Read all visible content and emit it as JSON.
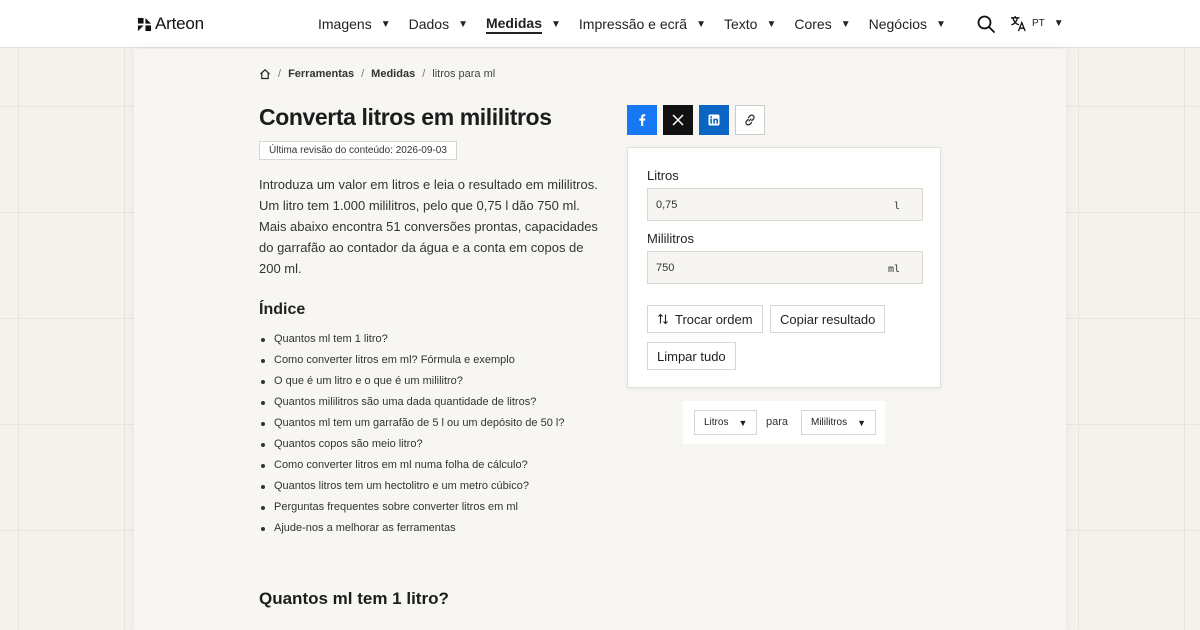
{
  "header": {
    "brand": "Arteon",
    "nav": [
      {
        "label": "Imagens",
        "active": false
      },
      {
        "label": "Dados",
        "active": false
      },
      {
        "label": "Medidas",
        "active": true
      },
      {
        "label": "Impressão e ecrã",
        "active": false
      },
      {
        "label": "Texto",
        "active": false
      },
      {
        "label": "Cores",
        "active": false
      },
      {
        "label": "Negócios",
        "active": false
      }
    ],
    "lang_code": "PT"
  },
  "breadcrumb": {
    "items": [
      "Ferramentas",
      "Medidas"
    ],
    "current": "litros para ml"
  },
  "page": {
    "title": "Converta litros em mililitros",
    "revision": "Última revisão do conteúdo: 2026-09-03",
    "intro": "Introduza um valor em litros e leia o resultado em mililitros. Um litro tem 1.000 mililitros, pelo que 0,75 l dão 750 ml. Mais abaixo encontra 51 conversões prontas, capacidades do garrafão ao contador da água e a conta em copos de 200 ml.",
    "toc_title": "Índice",
    "toc": [
      "Quantos ml tem 1 litro?",
      "Como converter litros em ml? Fórmula e exemplo",
      "O que é um litro e o que é um mililitro?",
      "Quantos mililitros são uma dada quantidade de litros?",
      "Quantos ml tem um garrafão de 5 l ou um depósito de 50 l?",
      "Quantos copos são meio litro?",
      "Como converter litros em ml numa folha de cálculo?",
      "Quantos litros tem um hectolitro e um metro cúbico?",
      "Perguntas frequentes sobre converter litros em ml",
      "Ajude-nos a melhorar as ferramentas"
    ],
    "section_title": "Quantos ml tem 1 litro?"
  },
  "converter": {
    "from_label": "Litros",
    "from_value": "0,75",
    "from_unit": "l",
    "to_label": "Mililitros",
    "to_value": "750",
    "to_unit": "ml",
    "swap_label": "Trocar ordem",
    "copy_label": "Copiar resultado",
    "clear_label": "Limpar tudo"
  },
  "unit_switch": {
    "from": "Litros",
    "connector": "para",
    "to": "Mililitros"
  },
  "colors": {
    "facebook": "#1877f2",
    "x": "#111111",
    "linkedin": "#0a66c2",
    "background": "#f5f2ee"
  }
}
